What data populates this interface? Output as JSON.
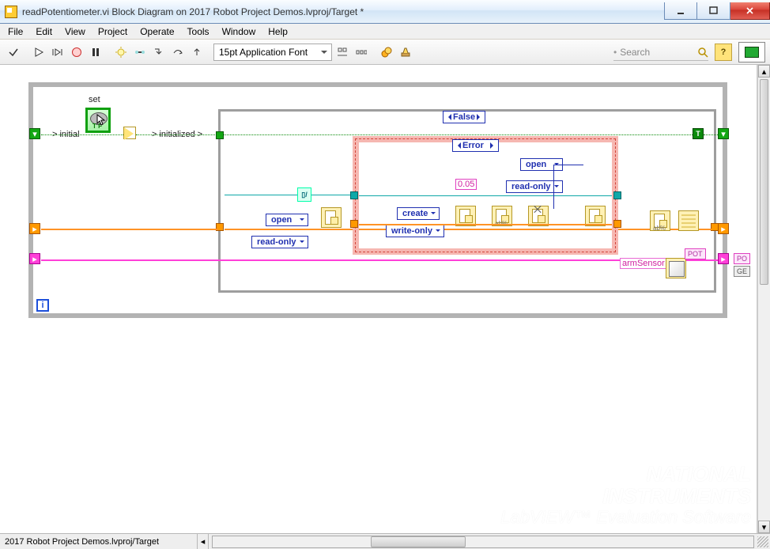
{
  "window": {
    "title": "readPotentiometer.vi Block Diagram on 2017 Robot Project Demos.lvproj/Target *"
  },
  "menu": [
    "File",
    "Edit",
    "View",
    "Project",
    "Operate",
    "Tools",
    "Window",
    "Help"
  ],
  "toolbar": {
    "font": "15pt Application Font",
    "search_placeholder": "Search",
    "help_glyph": "?"
  },
  "diagram": {
    "set_label": "set",
    "initialize_label_left": "> initial",
    "initialize_label_right": "> initialized >",
    "case_outer_value": "False",
    "case_inner_value": "Error",
    "ring_open": "open",
    "ring_readonly": "read-only",
    "ring_create": "create",
    "ring_writeonly": "write-only",
    "ring_open2": "open",
    "ring_readonly2": "read-only",
    "const_dbl": "0.05",
    "armSensor_label": "armSensor",
    "pot_label": "POT",
    "pot_label2": "PO",
    "ge_label": "GE",
    "i_label": "i",
    "bool_true": "T"
  },
  "status": {
    "path": "2017 Robot Project Demos.lvproj/Target"
  },
  "watermark": {
    "line1": "NATIONAL",
    "line2": "INSTRUMENTS",
    "line3": "LabVIEW™ Evaluation Software"
  }
}
